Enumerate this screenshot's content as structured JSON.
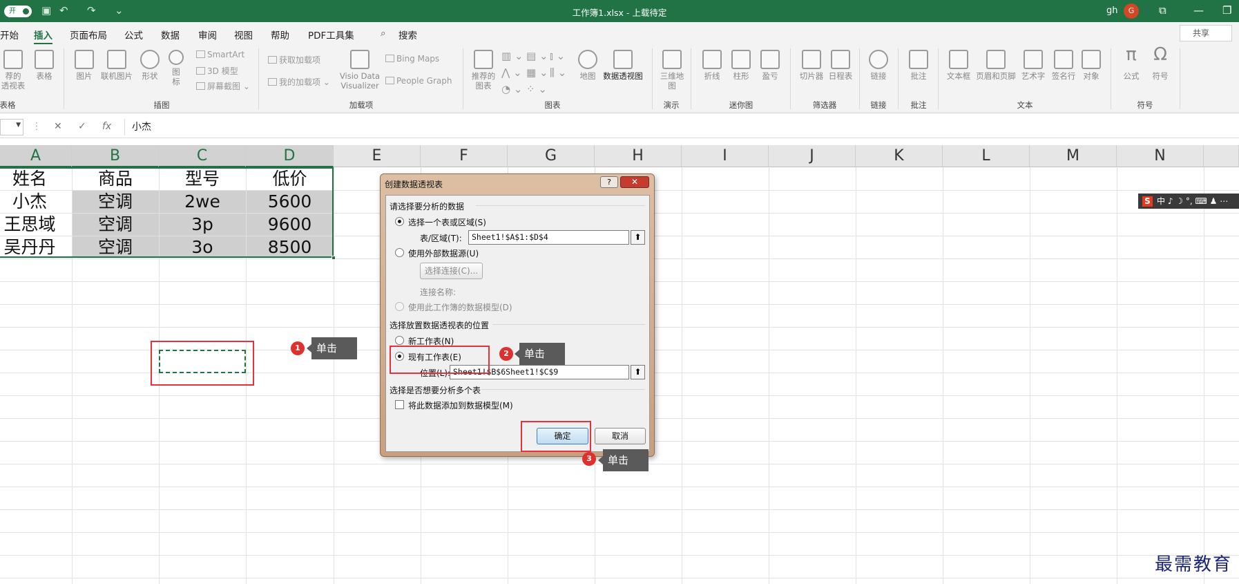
{
  "titlebar": {
    "autosave_toggle": "开",
    "title": "工作簿1.xlsx - 上载待定",
    "user": "gh",
    "avatar": "G"
  },
  "tabs": [
    "开始",
    "插入",
    "页面布局",
    "公式",
    "数据",
    "审阅",
    "视图",
    "帮助",
    "PDF工具集"
  ],
  "active_tab": "插入",
  "search": {
    "label": "搜索"
  },
  "share": {
    "label": "共享"
  },
  "ribbon": {
    "groups": {
      "tables": "表格",
      "illustrations": "插图",
      "addins": "加载项",
      "charts": "图表",
      "tours": "演示",
      "sparklines": "迷你图",
      "filters": "筛选器",
      "links": "链接",
      "comments": "批注",
      "text": "文本",
      "symbols": "符号"
    },
    "buttons": {
      "recommended_pivot": "荐的\n透视表",
      "table": "表格",
      "pictures": "图片",
      "online_pictures": "联机图片",
      "shapes": "形状",
      "icons": "图\n标",
      "smartart": "SmartArt",
      "model3d": "3D 模型",
      "screenshot": "屏幕截图",
      "get_addins": "获取加载项",
      "my_addins": "我的加载项",
      "visio": "Visio Data\nVisualizer",
      "bing_maps": "Bing Maps",
      "people_graph": "People Graph",
      "recommended_charts": "推荐的\n图表",
      "maps": "地图",
      "pivotchart": "数据透视图",
      "map3d": "三维地\n图",
      "line": "折线",
      "column": "柱形",
      "winloss": "盈亏",
      "slicer": "切片器",
      "timeline": "日程表",
      "link": "链接",
      "comment": "批注",
      "textbox": "文本框",
      "header_footer": "页眉和页脚",
      "wordart": "艺术字",
      "signature": "签名行",
      "object": "对象",
      "equation": "公式",
      "symbol": "符号"
    }
  },
  "formula_bar": {
    "fx": "fx",
    "content": "小杰"
  },
  "columns": [
    "A",
    "B",
    "C",
    "D",
    "E",
    "F",
    "G",
    "H",
    "I",
    "J",
    "K",
    "L",
    "M",
    "N"
  ],
  "table": {
    "headers": [
      "姓名",
      "商品",
      "型号",
      "低价"
    ],
    "rows": [
      [
        "小杰",
        "空调",
        "2we",
        "5600"
      ],
      [
        "王思域",
        "空调",
        "3p",
        "9600"
      ],
      [
        "吴丹丹",
        "空调",
        "3o",
        "8500"
      ]
    ]
  },
  "ime_toolbar": "中 ♪ ☽ °, ⌨ ♟ ⋯",
  "ime_logo": "S",
  "dialog": {
    "title": "创建数据透视表",
    "help": "?",
    "close": "✕",
    "section1": "请选择要分析的数据",
    "opt_range": "选择一个表或区域(S)",
    "range_label": "表/区域(T):",
    "range_value": "Sheet1!$A$1:$D$4",
    "opt_external": "使用外部数据源(U)",
    "choose_conn": "选择连接(C)...",
    "conn_name": "连接名称:",
    "opt_model": "使用此工作簿的数据模型(D)",
    "section2": "选择放置数据透视表的位置",
    "opt_new": "新工作表(N)",
    "opt_existing": "现有工作表(E)",
    "location_label": "位置(L):",
    "location_value": "Sheet1!$B$6Sheet1!$C$9",
    "section3": "选择是否想要分析多个表",
    "add_model": "将此数据添加到数据模型(M)",
    "ok": "确定",
    "cancel": "取消"
  },
  "callouts": [
    {
      "n": "1",
      "text": "单击"
    },
    {
      "n": "2",
      "text": "单击"
    },
    {
      "n": "3",
      "text": "单击"
    }
  ],
  "watermark": "最需教育",
  "colors": {
    "excel_green": "#217346",
    "callout_red": "#e0302d",
    "highlight_red": "#e8303a"
  }
}
